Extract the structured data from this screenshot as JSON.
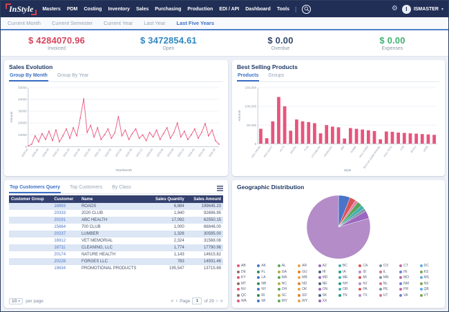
{
  "navbar": {
    "logo": "InStyle",
    "menu": [
      "Masters",
      "PDM",
      "Costing",
      "Inventory",
      "Sales",
      "Purchasing",
      "Production",
      "EDI / API",
      "Dashboard",
      "Tools"
    ],
    "separator": "|",
    "user": {
      "avatar_letter": "I",
      "name": "ISMASTER"
    }
  },
  "period_tabs": [
    {
      "label": "Current Month",
      "active": false
    },
    {
      "label": "Current Semester",
      "active": false
    },
    {
      "label": "Current Year",
      "active": false
    },
    {
      "label": "Last Year",
      "active": false
    },
    {
      "label": "Last Five Years",
      "active": true
    }
  ],
  "kpis": [
    {
      "value": "$ 4284070.96",
      "label": "Invoiced",
      "color": "#d6435c"
    },
    {
      "value": "$ 3472854.61",
      "label": "Open",
      "color": "#2e86c1"
    },
    {
      "value": "$ 0.00",
      "label": "Overdue",
      "color": "#33476b"
    },
    {
      "value": "$ 0.00",
      "label": "Expenses",
      "color": "#3eb26e"
    }
  ],
  "sales_evolution": {
    "title": "Sales Evolution",
    "tabs": [
      {
        "label": "Group By Month",
        "active": true
      },
      {
        "label": "Group By Year",
        "active": false
      }
    ],
    "chart": {
      "type": "line",
      "color": "#e8547c",
      "xlabel": "Year/Month",
      "ylabel": "Amount",
      "ylim": [
        0,
        50000
      ],
      "yticks": [
        0,
        10000,
        20000,
        30000,
        40000,
        50000
      ],
      "ytick_labels": [
        "0",
        "10000",
        "20000",
        "30000",
        "40000",
        "50000"
      ],
      "x": [
        "2020-03",
        "2020-04",
        "2020-05",
        "2020-06",
        "2020-07",
        "2020-08",
        "2020-09",
        "2020-10",
        "2020-11",
        "2020-12",
        "2021-01",
        "2021-02",
        "2021-03",
        "2021-04",
        "2021-05",
        "2021-06",
        "2021-07",
        "2021-08",
        "2021-09",
        "2021-10",
        "2021-11",
        "2021-12",
        "2022-01",
        "2022-02",
        "2022-03",
        "2022-04",
        "2022-05",
        "2022-06",
        "2022-07",
        "2022-08",
        "2022-09",
        "2022-10",
        "2022-11",
        "2022-12",
        "2023-01",
        "2023-02",
        "2023-03",
        "2023-04",
        "2023-05",
        "2023-06",
        "2023-07",
        "2023-08",
        "2023-09",
        "2023-10",
        "2023-11",
        "2023-12",
        "2024-01",
        "2024-02",
        "2024-03",
        "2024-04",
        "2024-05",
        "2024-06",
        "2024-07",
        "2024-08",
        "2024-09",
        "2024-10"
      ],
      "values": [
        500,
        2000,
        9000,
        4000,
        11000,
        6000,
        13000,
        5000,
        14000,
        4000,
        9000,
        15000,
        7000,
        16000,
        9000,
        24000,
        40500,
        12000,
        18000,
        8000,
        16000,
        6000,
        10000,
        15000,
        7000,
        12000,
        25500,
        9000,
        14000,
        6000,
        11000,
        15000,
        7000,
        10000,
        5000,
        12000,
        8000,
        14000,
        6000,
        11000,
        16000,
        7000,
        12000,
        20000,
        8000,
        13000,
        6000,
        10000,
        15000,
        7000,
        12000,
        19500,
        9000,
        14000,
        5000,
        2000
      ]
    }
  },
  "best_selling": {
    "title": "Best Selling Products",
    "tabs": [
      {
        "label": "Products",
        "active": true
      },
      {
        "label": "Groups",
        "active": false
      }
    ],
    "chart": {
      "type": "bar",
      "color": "#e8547c",
      "xlabel": "Style",
      "ylabel": "Amount",
      "ylim": [
        0,
        150000
      ],
      "yticks": [
        0,
        50000,
        100000,
        150000
      ],
      "ytick_labels": [
        "0",
        "50,000",
        "100,000",
        "150,000"
      ],
      "categories": [
        "MGC-PROM",
        "",
        "MGCJACKT",
        "",
        "IP170",
        "",
        "SRA001",
        "",
        "F128",
        "",
        "GT104B-GM",
        "",
        "CROM1007",
        "",
        "29M",
        "",
        "IK009F",
        "",
        "MGC-CHNO",
        "",
        "BECCHI-GIONI-WKEND",
        "",
        "MGC-TESS",
        "",
        "J159",
        "",
        "BGA11",
        "",
        "18000",
        ""
      ],
      "values": [
        40000,
        15000,
        60000,
        125000,
        100000,
        35000,
        65000,
        60000,
        58000,
        55000,
        28000,
        50000,
        46000,
        44000,
        14000,
        42000,
        40000,
        38000,
        36000,
        34000,
        12000,
        33000,
        32000,
        30000,
        29000,
        28000,
        27000,
        26000,
        25000,
        24000
      ]
    }
  },
  "top_customers": {
    "tabs": [
      {
        "label": "Top Customers Query",
        "active": true
      },
      {
        "label": "Top Customers",
        "active": false
      },
      {
        "label": "By Class",
        "active": false
      }
    ],
    "table": {
      "columns": [
        "Customer Group",
        "Customer",
        "Name",
        "Sales Quantity",
        "Sales Amount"
      ],
      "rows": [
        {
          "group": "",
          "customer": "16993",
          "name": "ROADS",
          "qty": "6,884",
          "amount": "199645.23"
        },
        {
          "group": "",
          "customer": "20333",
          "name": "2020 CLUB",
          "qty": "1,940",
          "amount": "92696.95"
        },
        {
          "group": "",
          "customer": "20191",
          "name": "ABC HEALTH",
          "qty": "17,092",
          "amount": "62550.15"
        },
        {
          "group": "",
          "customer": "15664",
          "name": "700 CLUB",
          "qty": "1,000",
          "amount": "66846.00"
        },
        {
          "group": "",
          "customer": "20237",
          "name": "LUMBER",
          "qty": "1,326",
          "amount": "30595.00"
        },
        {
          "group": "",
          "customer": "16912",
          "name": "VET MEMORIAL",
          "qty": "2,324",
          "amount": "31568.08"
        },
        {
          "group": "",
          "customer": "16711",
          "name": "CLEANING, LLC",
          "qty": "1,774",
          "amount": "17790.96"
        },
        {
          "group": "",
          "customer": "20174",
          "name": "NATURE HEALTH",
          "qty": "1,143",
          "amount": "14615.82"
        },
        {
          "group": "",
          "customer": "20228",
          "name": "FORGES LLC",
          "qty": "783",
          "amount": "14931.46"
        },
        {
          "group": "",
          "customer": "19634",
          "name": "PROMOTIONAL PRODUCTS",
          "qty": "195,547",
          "amount": "13715.69"
        }
      ]
    },
    "pager": {
      "page_size": "10",
      "per_page_label": "per page",
      "page_label": "Page",
      "current": "1",
      "of_label": "of 29"
    }
  },
  "geographic": {
    "title": "Geographic Distribution",
    "chart": {
      "type": "pie",
      "slices": [
        {
          "value": 6.0,
          "color": "#4a74c8"
        },
        {
          "value": 3.0,
          "color": "#d95457"
        },
        {
          "value": 1.5,
          "color": "#e083a8"
        },
        {
          "value": 2.5,
          "color": "#58a65c"
        },
        {
          "value": 2.0,
          "color": "#3fb0b0"
        },
        {
          "value": 1.5,
          "color": "#8093a8"
        },
        {
          "value": 4.0,
          "color": "#9b66c0"
        },
        {
          "value": 79.5,
          "color": "#b38cc8"
        }
      ]
    },
    "legend_states": [
      "AB",
      "AK",
      "AL",
      "AR",
      "AZ",
      "BC",
      "CA",
      "CO",
      "CT",
      "DC",
      "DE",
      "FL",
      "GA",
      "GU",
      "HI",
      "IA",
      "ID",
      "IL",
      "IN",
      "KS",
      "KY",
      "LA",
      "MA",
      "MB",
      "MD",
      "ME",
      "MI",
      "MN",
      "MO",
      "MS",
      "MT",
      "NB",
      "NC",
      "ND",
      "NE",
      "NH",
      "NJ",
      "NL",
      "NM",
      "NS",
      "NV",
      "NY",
      "OH",
      "OK",
      "ON",
      "OR",
      "PA",
      "PE",
      "PR",
      "QB",
      "QC",
      "RI",
      "SC",
      "SD",
      "SK",
      "TN",
      "TX",
      "UT",
      "VA",
      "VT",
      "WA",
      "WI",
      "WV",
      "WY",
      "XX"
    ],
    "palette": [
      "#e0557a",
      "#4a74c8",
      "#58a65c",
      "#e8a33d",
      "#9b66c0",
      "#3fb0b0",
      "#d95457",
      "#8093a8",
      "#c0699f",
      "#5dade2",
      "#8d6e63",
      "#2e8b57",
      "#b0b03a",
      "#e67e22",
      "#4a5d78",
      "#16a085",
      "#b38cc8",
      "#d4748c",
      "#6c7fd8",
      "#7aa84a"
    ]
  }
}
